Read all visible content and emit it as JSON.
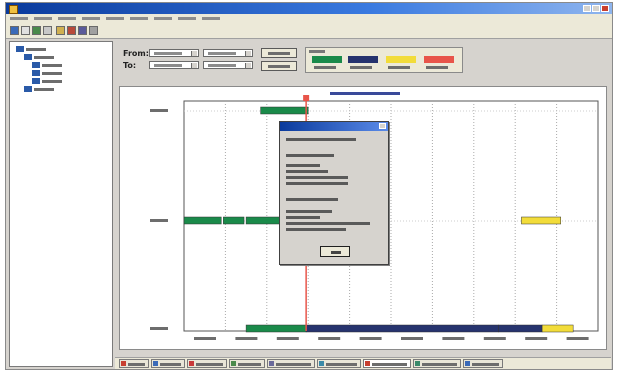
{
  "window": {
    "title": ""
  },
  "menu": {
    "items": [
      "",
      "",
      "",
      "",
      "",
      "",
      "",
      "",
      ""
    ]
  },
  "toolbar": {
    "buttons": [
      "",
      "",
      "",
      "",
      "",
      "",
      "",
      ""
    ]
  },
  "tree": {
    "nodes": [
      "",
      "",
      "",
      "",
      "",
      ""
    ]
  },
  "filters": {
    "from_label": "From:",
    "to_label": "To:",
    "from_date": "",
    "from_time": "",
    "to_date": "",
    "to_time": "",
    "button_top": "",
    "button_bottom": ""
  },
  "legend": {
    "title": "",
    "items": [
      {
        "label": "",
        "color": "#1a8a4a"
      },
      {
        "label": "",
        "color": "#26336e"
      },
      {
        "label": "",
        "color": "#f2dc3a"
      },
      {
        "label": "",
        "color": "#e8554a"
      }
    ]
  },
  "chart_data": {
    "type": "gantt",
    "title": "",
    "rows": [
      "",
      "",
      ""
    ],
    "x_ticks": [
      "",
      "",
      "",
      "",
      "",
      "",
      "",
      "",
      "",
      ""
    ],
    "bars": [
      {
        "row": 0,
        "start": 1.85,
        "end": 3.0,
        "state": 0,
        "label": ""
      },
      {
        "row": 1,
        "start": 0.0,
        "end": 0.9,
        "state": 0,
        "label": ""
      },
      {
        "row": 1,
        "start": 0.95,
        "end": 1.45,
        "state": 0,
        "label": ""
      },
      {
        "row": 1,
        "start": 1.5,
        "end": 2.85,
        "state": 0,
        "label": ""
      },
      {
        "row": 1,
        "start": 8.15,
        "end": 9.1,
        "state": 2,
        "label": ""
      },
      {
        "row": 2,
        "start": 1.5,
        "end": 2.95,
        "state": 0,
        "label": ""
      },
      {
        "row": 2,
        "start": 2.95,
        "end": 7.6,
        "state": 1,
        "label": ""
      },
      {
        "row": 2,
        "start": 7.6,
        "end": 8.65,
        "state": 1,
        "label": ""
      },
      {
        "row": 2,
        "start": 8.65,
        "end": 9.4,
        "state": 2,
        "label": ""
      }
    ],
    "marker": {
      "x": 2.95,
      "color": "#e8554a"
    }
  },
  "dialog": {
    "title": "",
    "lines": [
      "",
      "",
      "",
      "",
      "",
      "",
      "",
      "",
      "",
      "",
      ""
    ],
    "ok_label": ""
  },
  "status_tabs": [
    "",
    "",
    "",
    "",
    "",
    "",
    "",
    "",
    ""
  ]
}
